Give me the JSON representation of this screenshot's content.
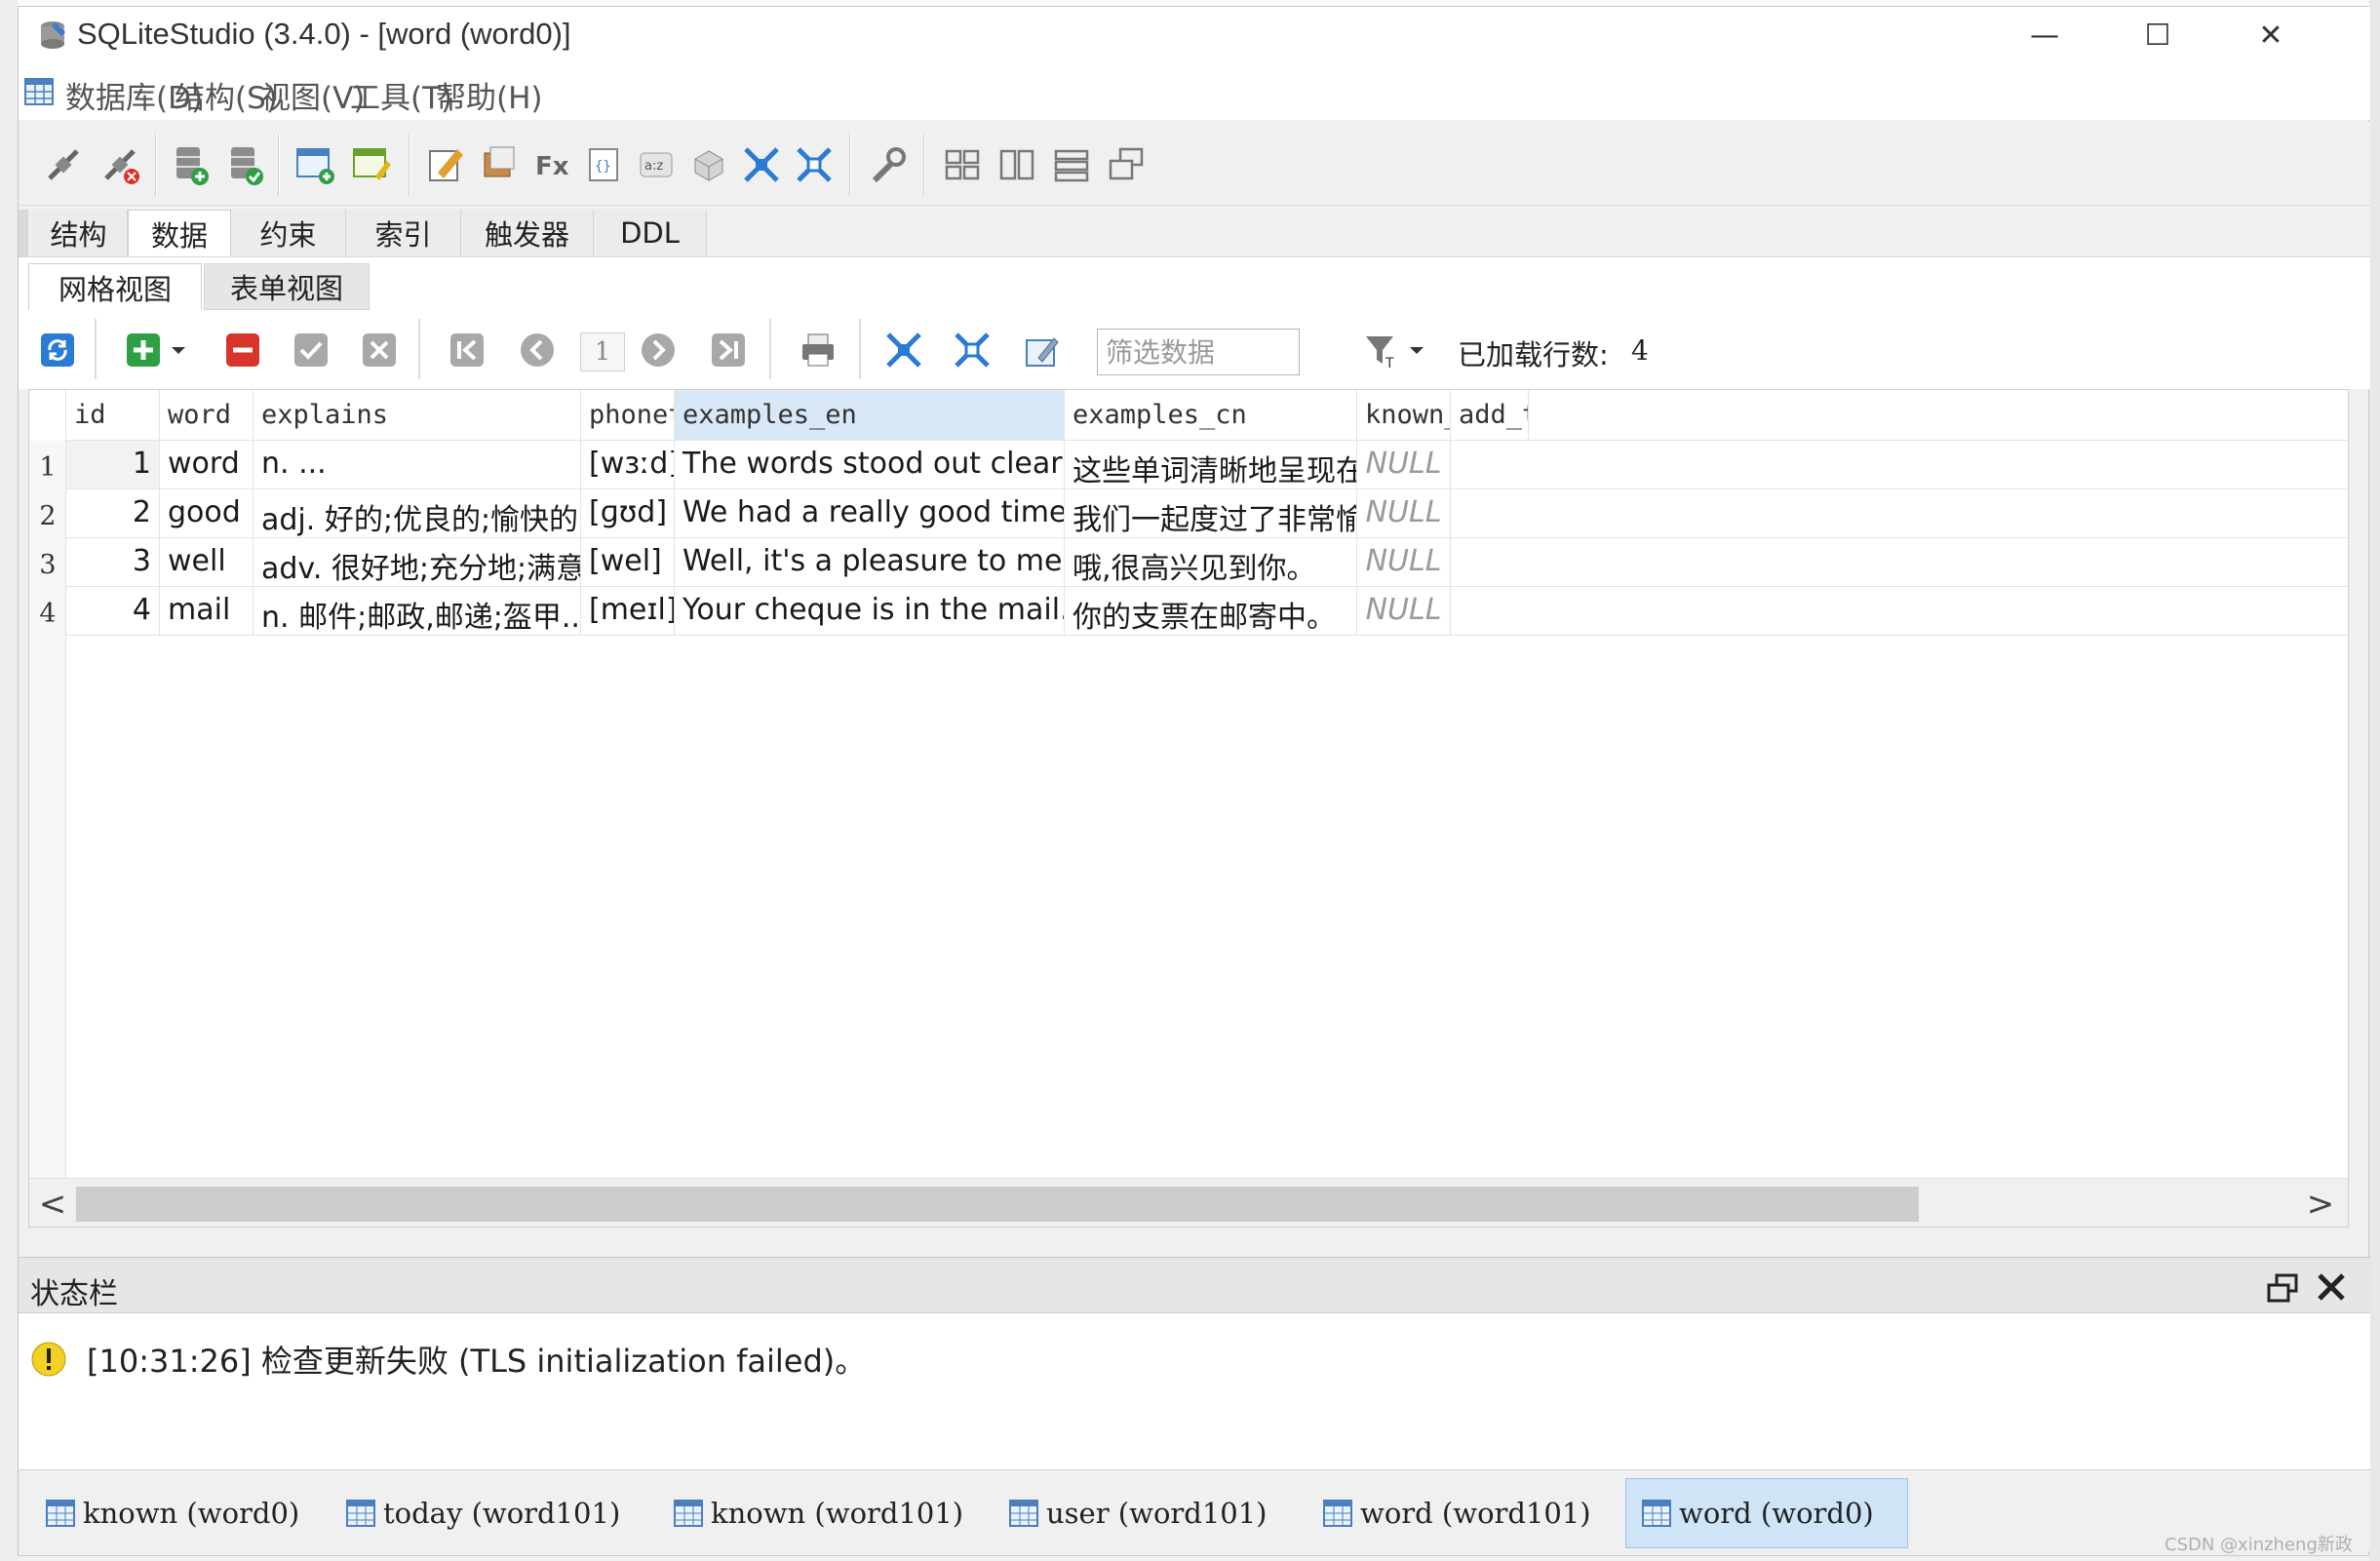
{
  "window": {
    "title": "SQLiteStudio (3.4.0) - [word (word0)]",
    "min_glyph": "—",
    "max_glyph": "☐",
    "close_glyph": "✕"
  },
  "menu": [
    "数据库(D)",
    "结构(S)",
    "视图(V)",
    "工具(T)",
    "帮助(H)"
  ],
  "object_tabs": [
    "结构",
    "数据",
    "约束",
    "索引",
    "触发器",
    "DDL"
  ],
  "view_tabs": [
    "网格视图",
    "表单视图"
  ],
  "data_toolbar": {
    "page": "1",
    "filter_placeholder": "筛选数据",
    "rows_loaded_label": "已加载行数:",
    "rows_loaded_count": "4"
  },
  "grid": {
    "columns": [
      "id",
      "word",
      "explains",
      "phonetic",
      "examples_en",
      "examples_cn",
      "known_tim",
      "add_time"
    ],
    "rows": [
      {
        "rownum": "1",
        "id": "1",
        "word": "word",
        "explains": "n. ...",
        "phonetic": "[wɜːd]",
        "examples_en": "The words stood out clearly on the page.",
        "examples_cn": "这些单词清晰地呈现在页面上。",
        "known_time": "NULL",
        "add_time": ""
      },
      {
        "rownum": "2",
        "id": "2",
        "word": "good",
        "explains": "adj. 好的;优良的;愉快的;...",
        "phonetic": "[ɡʊd]",
        "examples_en": "We had a really good time together.",
        "examples_cn": "我们一起度过了非常愉快的时光。",
        "known_time": "NULL",
        "add_time": ""
      },
      {
        "rownum": "3",
        "id": "3",
        "word": "well",
        "explains": "adv. 很好地;充分地;满意地;...",
        "phonetic": "[wel]",
        "examples_en": "Well, it's a pleasure to meet you.",
        "examples_cn": "哦,很高兴见到你。",
        "known_time": "NULL",
        "add_time": ""
      },
      {
        "rownum": "4",
        "id": "4",
        "word": "mail",
        "explains": "n. 邮件;邮政,邮递;盔甲...",
        "phonetic": "[meɪl]",
        "examples_en": "Your cheque is in the mail.",
        "examples_cn": "你的支票在邮寄中。",
        "known_time": "NULL",
        "add_time": ""
      }
    ],
    "scroll_left": "<",
    "scroll_right": ">"
  },
  "status": {
    "title": "状态栏",
    "message": "[10:31:26] 检查更新失败 (TLS initialization failed)。"
  },
  "window_tabs": [
    {
      "label": "known (word0)",
      "active": false
    },
    {
      "label": "today (word101)",
      "active": false
    },
    {
      "label": "known (word101)",
      "active": false
    },
    {
      "label": "user (word101)",
      "active": false
    },
    {
      "label": "word (word101)",
      "active": false
    },
    {
      "label": "word (word0)",
      "active": true
    }
  ],
  "watermark": "CSDN @xinzheng新政",
  "colors": {
    "selected_header": "#d8e8f7",
    "active_tab": "#cfe5f7",
    "null_text": "#9a9a9a"
  }
}
